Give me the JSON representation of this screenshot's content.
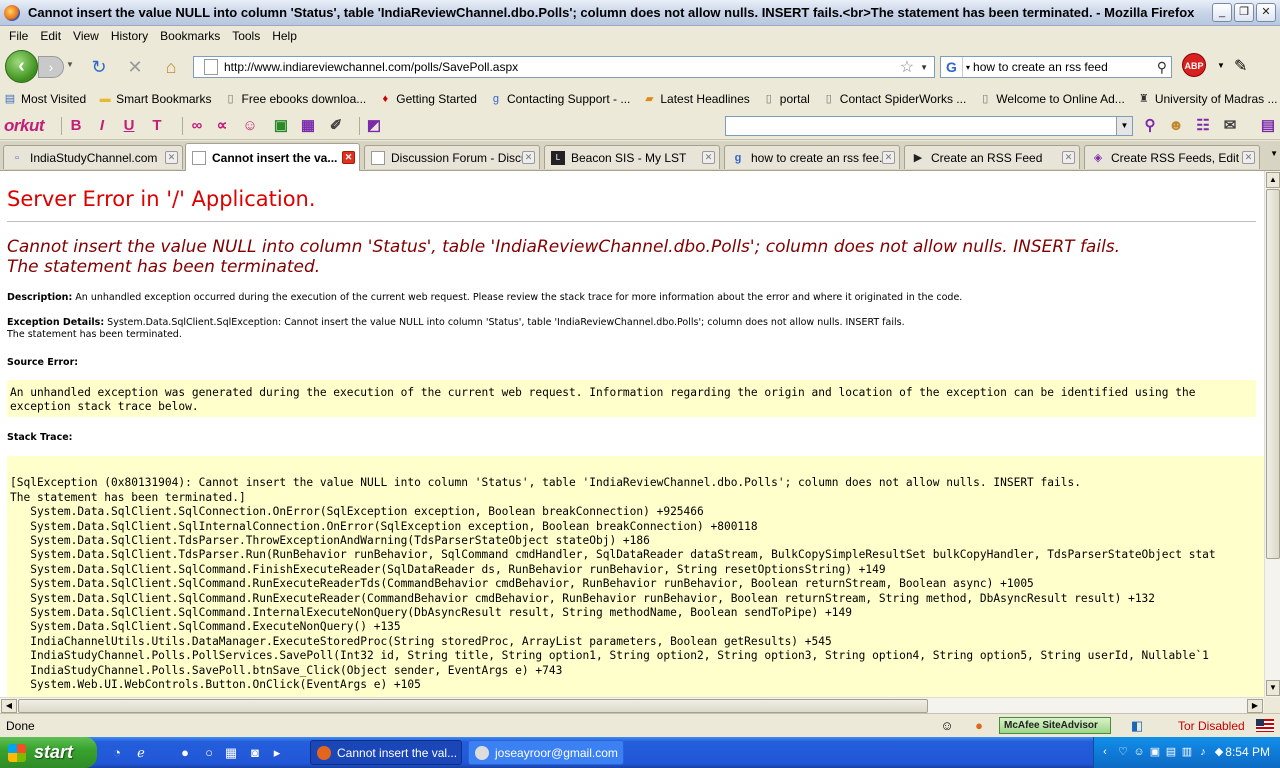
{
  "window": {
    "title": "Cannot insert the value NULL into column 'Status', table 'IndiaReviewChannel.dbo.Polls'; column does not allow nulls. INSERT fails.<br>The statement has been terminated. - Mozilla Firefox"
  },
  "menu": [
    "File",
    "Edit",
    "View",
    "History",
    "Bookmarks",
    "Tools",
    "Help"
  ],
  "nav": {
    "url": "http://www.indiareviewchannel.com/polls/SavePoll.aspx",
    "search_value": "how to create an rss feed",
    "abp_label": "ABP"
  },
  "bookmarks": [
    {
      "label": "Most Visited",
      "icon": "bookmark-folder-icon",
      "color": "#3B6DBF"
    },
    {
      "label": "Smart Bookmarks",
      "icon": "folder-icon",
      "color": "#E8B830"
    },
    {
      "label": "Free ebooks downloa...",
      "icon": "page-icon",
      "color": "#777777"
    },
    {
      "label": "Getting Started",
      "icon": "firefox-icon",
      "color": "#CC0000"
    },
    {
      "label": "Contacting Support - ...",
      "icon": "google-icon",
      "color": "#3366CC"
    },
    {
      "label": "Latest Headlines",
      "icon": "rss-icon",
      "color": "#E08A1E"
    },
    {
      "label": "portal",
      "icon": "page-icon",
      "color": "#777777"
    },
    {
      "label": "Contact SpiderWorks ...",
      "icon": "page-icon",
      "color": "#777777"
    },
    {
      "label": "Welcome to Online Ad...",
      "icon": "page-icon",
      "color": "#777777"
    },
    {
      "label": "University of Madras ...",
      "icon": "university-icon",
      "color": "#333333"
    }
  ],
  "orkut": {
    "logo": "orkut"
  },
  "tabs": [
    {
      "label": "IndiaStudyChannel.com",
      "active": false
    },
    {
      "label": "Cannot insert the va...",
      "active": true
    },
    {
      "label": "Discussion Forum - Discu...",
      "active": false
    },
    {
      "label": "Beacon SIS - My LST",
      "active": false
    },
    {
      "label": "how to create an rss fee...",
      "active": false
    },
    {
      "label": "Create an RSS Feed",
      "active": false
    },
    {
      "label": "Create RSS Feeds, Edit ...",
      "active": false
    }
  ],
  "page": {
    "heading": "Server Error in '/' Application.",
    "error_message_line1": "Cannot insert the value NULL into column 'Status', table 'IndiaReviewChannel.dbo.Polls'; column does not allow nulls. INSERT fails.",
    "error_message_line2": "The statement has been terminated.",
    "description_label": "Description:",
    "description_text": "An unhandled exception occurred during the execution of the current web request. Please review the stack trace for more information about the error and where it originated in the code.",
    "exception_label": "Exception Details:",
    "exception_text_line1": "System.Data.SqlClient.SqlException: Cannot insert the value NULL into column 'Status', table 'IndiaReviewChannel.dbo.Polls'; column does not allow nulls. INSERT fails.",
    "exception_text_line2": "The statement has been terminated.",
    "source_error_label": "Source Error:",
    "source_error_text": "An unhandled exception was generated during the execution of the current web request. Information regarding the origin and location of the exception can be identified using the\nexception stack trace below.",
    "stack_trace_label": "Stack Trace:",
    "stack_trace_lines": [
      "",
      "[SqlException (0x80131904): Cannot insert the value NULL into column 'Status', table 'IndiaReviewChannel.dbo.Polls'; column does not allow nulls. INSERT fails.",
      "The statement has been terminated.]",
      "   System.Data.SqlClient.SqlConnection.OnError(SqlException exception, Boolean breakConnection) +925466",
      "   System.Data.SqlClient.SqlInternalConnection.OnError(SqlException exception, Boolean breakConnection) +800118",
      "   System.Data.SqlClient.TdsParser.ThrowExceptionAndWarning(TdsParserStateObject stateObj) +186",
      "   System.Data.SqlClient.TdsParser.Run(RunBehavior runBehavior, SqlCommand cmdHandler, SqlDataReader dataStream, BulkCopySimpleResultSet bulkCopyHandler, TdsParserStateObject stat",
      "   System.Data.SqlClient.SqlCommand.FinishExecuteReader(SqlDataReader ds, RunBehavior runBehavior, String resetOptionsString) +149",
      "   System.Data.SqlClient.SqlCommand.RunExecuteReaderTds(CommandBehavior cmdBehavior, RunBehavior runBehavior, Boolean returnStream, Boolean async) +1005",
      "   System.Data.SqlClient.SqlCommand.RunExecuteReader(CommandBehavior cmdBehavior, RunBehavior runBehavior, Boolean returnStream, String method, DbAsyncResult result) +132",
      "   System.Data.SqlClient.SqlCommand.InternalExecuteNonQuery(DbAsyncResult result, String methodName, Boolean sendToPipe) +149",
      "   System.Data.SqlClient.SqlCommand.ExecuteNonQuery() +135",
      "   IndiaChannelUtils.Utils.DataManager.ExecuteStoredProc(String storedProc, ArrayList parameters, Boolean getResults) +545",
      "   IndiaStudyChannel.Polls.PollServices.SavePoll(Int32 id, String title, String option1, String option2, String option3, String option4, String option5, String userId, Nullable`1",
      "   IndiaStudyChannel.Polls.SavePoll.btnSave_Click(Object sender, EventArgs e) +743",
      "   System.Web.UI.WebControls.Button.OnClick(EventArgs e) +105"
    ]
  },
  "status": {
    "text": "Done",
    "mcafee_label": "McAfee SiteAdvisor",
    "tor_label": "Tor Disabled"
  },
  "taskbar": {
    "start_label": "start",
    "tasks": [
      {
        "label": "Cannot insert the val...",
        "active": true,
        "color": "#E4661C"
      },
      {
        "label": "joseayroor@gmail.com",
        "active": false,
        "color": "#DDDDDD"
      }
    ],
    "clock": "8:54 PM"
  },
  "colors": {
    "heading_red": "#DD0000",
    "error_maroon": "#800000",
    "code_background": "#FFFFCC",
    "taskbar_blue": "#245EDB",
    "start_green": "#38A32E"
  }
}
